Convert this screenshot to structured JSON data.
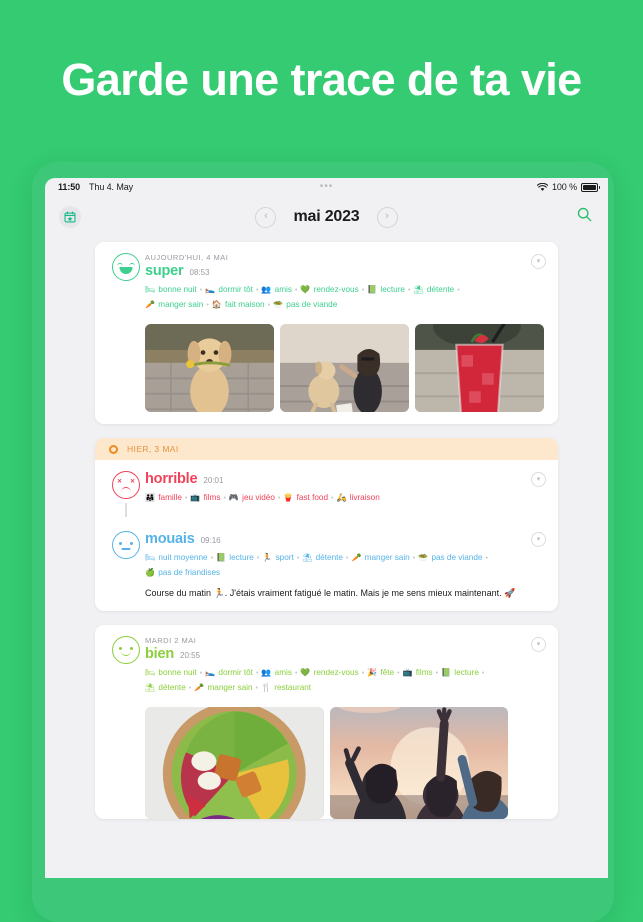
{
  "headline": "Garde une trace de ta vie",
  "colors": {
    "background": "#34cb72",
    "device_frame": "#3cc878",
    "screen": "#f1f1f4",
    "accent_green": "#2fbf6e",
    "super": "#3ecf8e",
    "bien": "#8cce3c",
    "mouais": "#56b3e8",
    "horrible": "#f2425a",
    "day_header_bg": "#fde8cd",
    "day_header_text": "#e59340"
  },
  "status_bar": {
    "time": "11:50",
    "date": "Thu 4. May",
    "dots": "•••",
    "wifi_icon": "wifi-icon",
    "battery_percent": "100 %",
    "battery_icon": "battery-full-icon"
  },
  "nav": {
    "calendar_icon": "calendar-star-icon",
    "prev_label": "‹",
    "next_label": "›",
    "title": "mai 2023",
    "search_icon": "search-icon"
  },
  "entries": [
    {
      "date_label": "AUJOURD'HUI, 4 MAI",
      "mood": "super",
      "mood_class": "m-super",
      "time": "08:53",
      "face": "laughing",
      "tags": [
        {
          "glyph": "🛏",
          "label": "bonne nuit"
        },
        {
          "glyph": "🛌",
          "label": "dormir tôt"
        },
        {
          "glyph": "👥",
          "label": "amis"
        },
        {
          "glyph": "💚",
          "label": "rendez-vous"
        },
        {
          "glyph": "📗",
          "label": "lecture"
        },
        {
          "glyph": "⛱",
          "label": "détente"
        },
        {
          "glyph": "🥕",
          "label": "manger sain"
        },
        {
          "glyph": "🏠",
          "label": "fait maison"
        },
        {
          "glyph": "🥗",
          "label": "pas de viande"
        }
      ],
      "note": "",
      "photos": [
        "puppy-with-flower",
        "woman-with-dog",
        "red-iced-drink"
      ]
    },
    {
      "date_label": "HIER, 3 MAI",
      "is_day_header": true,
      "mood": "horrible",
      "mood_class": "m-horrible",
      "time": "20:01",
      "face": "x-eyes-frown",
      "tags": [
        {
          "glyph": "👨‍👩‍👧",
          "label": "famille"
        },
        {
          "glyph": "📺",
          "label": "films"
        },
        {
          "glyph": "🎮",
          "label": "jeu vidéo"
        },
        {
          "glyph": "🍟",
          "label": "fast food"
        },
        {
          "glyph": "🛵",
          "label": "livraison"
        }
      ],
      "note": "",
      "photos": []
    },
    {
      "date_label": "",
      "mood": "mouais",
      "mood_class": "m-mouais",
      "time": "09:16",
      "face": "neutral",
      "tags": [
        {
          "glyph": "🛏",
          "label": "nuit moyenne"
        },
        {
          "glyph": "📗",
          "label": "lecture"
        },
        {
          "glyph": "🏃",
          "label": "sport"
        },
        {
          "glyph": "⛱",
          "label": "détente"
        },
        {
          "glyph": "🥕",
          "label": "manger sain"
        },
        {
          "glyph": "🥗",
          "label": "pas de viande"
        },
        {
          "glyph": "🍏",
          "label": "pas de friandises"
        }
      ],
      "note": "Course du matin 🏃. J'étais vraiment fatigué le matin. Mais je me sens mieux maintenant. 🚀",
      "photos": []
    },
    {
      "date_label": "MARDI 2 MAI",
      "mood": "bien",
      "mood_class": "m-bien",
      "time": "20:55",
      "face": "smile",
      "tags": [
        {
          "glyph": "🛏",
          "label": "bonne nuit"
        },
        {
          "glyph": "🛌",
          "label": "dormir tôt"
        },
        {
          "glyph": "👥",
          "label": "amis"
        },
        {
          "glyph": "💚",
          "label": "rendez-vous"
        },
        {
          "glyph": "🎉",
          "label": "fête"
        },
        {
          "glyph": "📺",
          "label": "films"
        },
        {
          "glyph": "📗",
          "label": "lecture"
        },
        {
          "glyph": "⛱",
          "label": "détente"
        },
        {
          "glyph": "🥕",
          "label": "manger sain"
        },
        {
          "glyph": "🍴",
          "label": "restaurant"
        }
      ],
      "note": "",
      "photos": [
        "salad-bowl",
        "friends-at-sunset"
      ]
    }
  ],
  "collapse_icon": "chevron-down-icon",
  "separator": "•"
}
